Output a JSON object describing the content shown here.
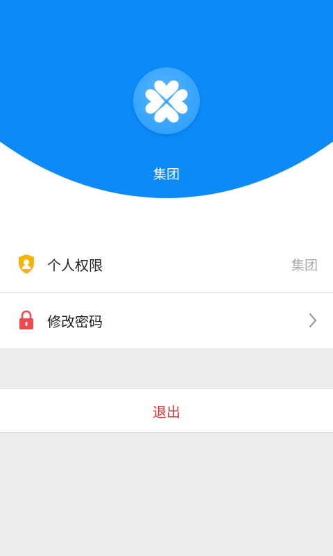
{
  "header": {
    "org_name": "集团",
    "logo_icon": "clover-logo-icon",
    "background_color": "#0b8af8"
  },
  "menu": {
    "items": [
      {
        "label": "个人权限",
        "value": "集团",
        "icon": "shield-user-icon",
        "icon_color": "#f6b40a"
      },
      {
        "label": "修改密码",
        "icon": "lock-icon",
        "icon_color": "#ef4a4f",
        "trailing_icon": "chevron-right-icon"
      }
    ]
  },
  "logout": {
    "label": "退出",
    "color": "#e1322f"
  }
}
